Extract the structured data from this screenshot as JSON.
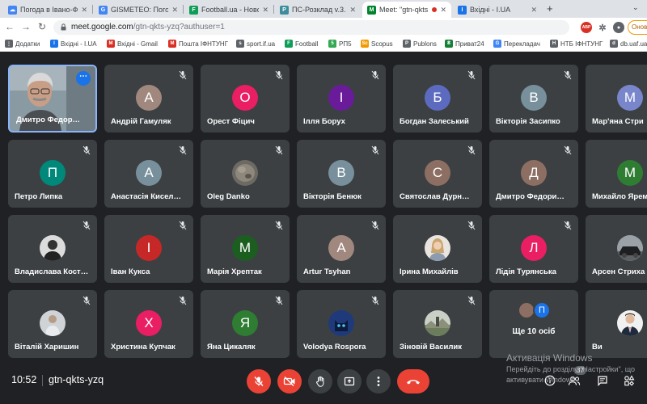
{
  "tabs": [
    {
      "label": "Погода в Івано-Фра",
      "fav_color": "#1a73e8",
      "fav_text": "☁"
    },
    {
      "label": "GISMETEO: Погода",
      "fav_color": "#4285f4",
      "fav_text": "G"
    },
    {
      "label": "Football.ua - Новос",
      "fav_color": "#0f9d58",
      "fav_text": "F"
    },
    {
      "label": "ПС-Розклад v.3.8.2",
      "fav_color": "#3c8c9c",
      "fav_text": "P"
    },
    {
      "label": "Meet: \"gtn-qkts",
      "fav_color": "#00832d",
      "fav_text": "M"
    },
    {
      "label": "Вхідні - I.UA",
      "fav_color": "#1a73e8",
      "fav_text": "I"
    }
  ],
  "address": {
    "host": "meet.google.com",
    "path": "/gtn-qkts-yzq?authuser=1"
  },
  "profile_label": "Онов",
  "bookmarks": [
    {
      "label": "Додатки",
      "color": "#5f6368",
      "text": "⋮"
    },
    {
      "label": "Вхідні - I.UA",
      "color": "#1a73e8",
      "text": "I"
    },
    {
      "label": "Вхідні - Gmail",
      "color": "#d93025",
      "text": "M"
    },
    {
      "label": "Пошта ІФНТУНГ",
      "color": "#d93025",
      "text": "M"
    },
    {
      "label": "sport.if.ua",
      "color": "#5f6368",
      "text": "s"
    },
    {
      "label": "Football",
      "color": "#0f9d58",
      "text": "F"
    },
    {
      "label": "РП5",
      "color": "#34a853",
      "text": "5"
    },
    {
      "label": "Scopus",
      "color": "#f29900",
      "text": "Sc"
    },
    {
      "label": "Publons",
      "color": "#5f6368",
      "text": "P"
    },
    {
      "label": "Приват24",
      "color": "#188038",
      "text": "₴"
    },
    {
      "label": "Перекладач",
      "color": "#4285f4",
      "text": "G"
    },
    {
      "label": "НТБ ІФНТУНГ",
      "color": "#5f6368",
      "text": "Н"
    },
    {
      "label": "db.uaf.ua",
      "color": "#5f6368",
      "text": "d"
    }
  ],
  "participants": [
    {
      "name": "Дмитро Федор…",
      "kind": "self"
    },
    {
      "name": "Андрій Гамуляк",
      "initial": "А",
      "color": "#a1887f"
    },
    {
      "name": "Орест Фіцич",
      "initial": "О",
      "color": "#e91e63"
    },
    {
      "name": "Ілля Борух",
      "initial": "І",
      "color": "#6a1b9a"
    },
    {
      "name": "Богдан Залеський",
      "initial": "Б",
      "color": "#5c6bc0"
    },
    {
      "name": "Вікторія Засипко",
      "initial": "В",
      "color": "#78909c"
    },
    {
      "name": "Мар'яна Стри",
      "initial": "М",
      "color": "#7986cb"
    },
    {
      "name": "Петро Липка",
      "initial": "П",
      "color": "#00897b"
    },
    {
      "name": "Анастасія Кисел…",
      "initial": "А",
      "color": "#78909c"
    },
    {
      "name": "Oleg Danko",
      "kind": "photo",
      "photo": "stone"
    },
    {
      "name": "Вікторія Бенюк",
      "initial": "В",
      "color": "#78909c"
    },
    {
      "name": "Святослав Дурн…",
      "initial": "С",
      "color": "#8d6e63"
    },
    {
      "name": "Дмитро Федори…",
      "initial": "Д",
      "color": "#8d6e63"
    },
    {
      "name": "Михайло Ярем",
      "initial": "М",
      "color": "#2e7d32"
    },
    {
      "name": "Владислава Кост…",
      "kind": "photo",
      "photo": "person-dark"
    },
    {
      "name": "Іван Кукса",
      "initial": "І",
      "color": "#c62828"
    },
    {
      "name": "Марія Хрептак",
      "initial": "М",
      "color": "#1b5e20"
    },
    {
      "name": "Artur Tsyhan",
      "initial": "А",
      "color": "#a1887f"
    },
    {
      "name": "Ірина Михайлів",
      "kind": "photo",
      "photo": "woman"
    },
    {
      "name": "Лідія Турянська",
      "initial": "Л",
      "color": "#e91e63"
    },
    {
      "name": "Арсен Стриха",
      "kind": "photo",
      "photo": "car"
    },
    {
      "name": "Віталій Харишин",
      "kind": "photo",
      "photo": "person-light"
    },
    {
      "name": "Христина Купчак",
      "initial": "Х",
      "color": "#e91e63"
    },
    {
      "name": "Яна Цикаляк",
      "initial": "Я",
      "color": "#2e7d32"
    },
    {
      "name": "Volodya Rospora",
      "kind": "photo",
      "photo": "cat"
    },
    {
      "name": "Зіновій Василик",
      "kind": "photo",
      "photo": "landscape"
    },
    {
      "name": "Ще 10 осіб",
      "kind": "more",
      "more_initial": "П",
      "more_color": "#1a73e8"
    },
    {
      "name": "Ви",
      "kind": "photo",
      "photo": "man-suit"
    }
  ],
  "bottom": {
    "time": "10:52",
    "meeting_code": "gtn-qkts-yzq",
    "people_count": "37"
  },
  "watermark": {
    "title": "Активація Windows",
    "line1": "Перейдіть до розділу \"Настройки\", що",
    "line2": "активувати Windows."
  },
  "colors": {
    "meet_bg": "#202124",
    "tile_bg": "#3c4043",
    "danger": "#ea4335",
    "self_border": "#8ab4f8"
  }
}
